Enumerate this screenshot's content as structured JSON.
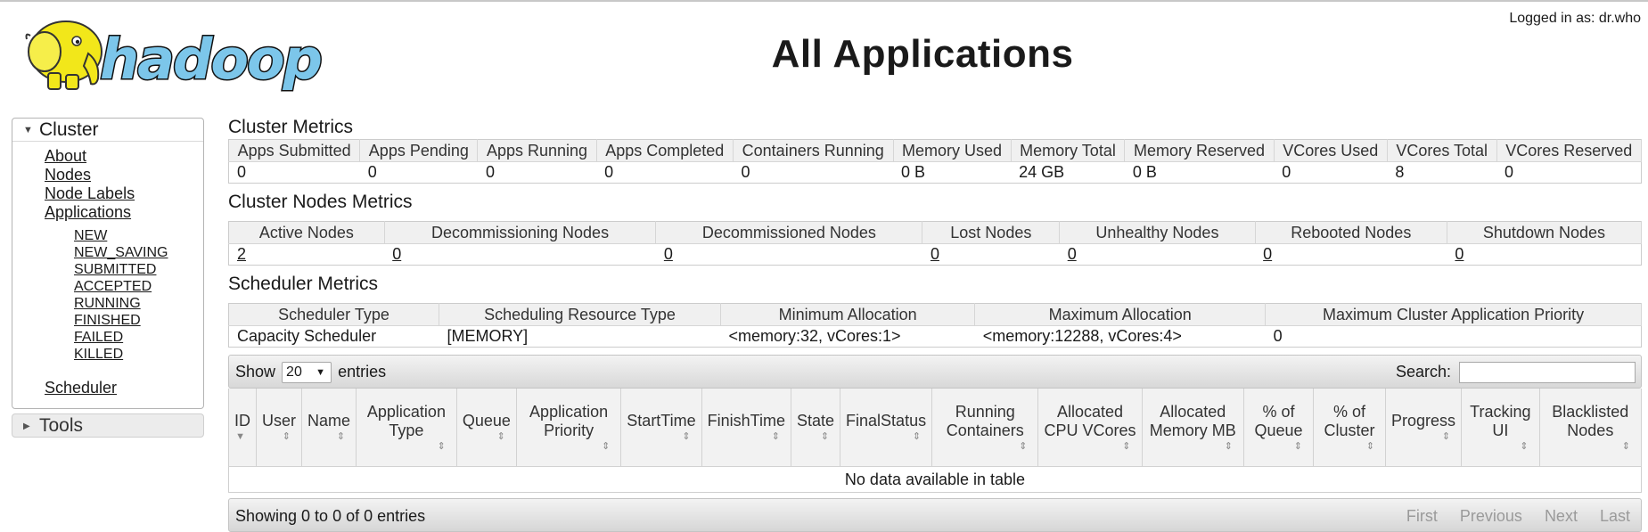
{
  "header": {
    "logo_text": "hadoop",
    "title": "All Applications",
    "user_info": "Logged in as: dr.who"
  },
  "sidebar": {
    "cluster_label": "Cluster",
    "links": [
      "About",
      "Nodes",
      "Node Labels",
      "Applications"
    ],
    "app_states": [
      "NEW",
      "NEW_SAVING",
      "SUBMITTED",
      "ACCEPTED",
      "RUNNING",
      "FINISHED",
      "FAILED",
      "KILLED"
    ],
    "scheduler_label": "Scheduler",
    "tools_label": "Tools"
  },
  "cluster_metrics": {
    "title": "Cluster Metrics",
    "headers": [
      "Apps Submitted",
      "Apps Pending",
      "Apps Running",
      "Apps Completed",
      "Containers Running",
      "Memory Used",
      "Memory Total",
      "Memory Reserved",
      "VCores Used",
      "VCores Total",
      "VCores Reserved"
    ],
    "values": [
      "0",
      "0",
      "0",
      "0",
      "0",
      "0 B",
      "24 GB",
      "0 B",
      "0",
      "8",
      "0"
    ]
  },
  "nodes_metrics": {
    "title": "Cluster Nodes Metrics",
    "headers": [
      "Active Nodes",
      "Decommissioning Nodes",
      "Decommissioned Nodes",
      "Lost Nodes",
      "Unhealthy Nodes",
      "Rebooted Nodes",
      "Shutdown Nodes"
    ],
    "values": [
      "2",
      "0",
      "0",
      "0",
      "0",
      "0",
      "0"
    ]
  },
  "scheduler_metrics": {
    "title": "Scheduler Metrics",
    "headers": [
      "Scheduler Type",
      "Scheduling Resource Type",
      "Minimum Allocation",
      "Maximum Allocation",
      "Maximum Cluster Application Priority"
    ],
    "values": [
      "Capacity Scheduler",
      "[MEMORY]",
      "<memory:32, vCores:1>",
      "<memory:12288, vCores:4>",
      "0"
    ]
  },
  "apps_table": {
    "show_label": "Show",
    "entries_label": "entries",
    "page_length": "20",
    "search_label": "Search:",
    "search_value": "",
    "columns": [
      "ID",
      "User",
      "Name",
      "Application Type",
      "Queue",
      "Application Priority",
      "StartTime",
      "FinishTime",
      "State",
      "FinalStatus",
      "Running Containers",
      "Allocated CPU VCores",
      "Allocated Memory MB",
      "% of Queue",
      "% of Cluster",
      "Progress",
      "Tracking UI",
      "Blacklisted Nodes"
    ],
    "empty_message": "No data available in table",
    "info": "Showing 0 to 0 of 0 entries",
    "pager": [
      "First",
      "Previous",
      "Next",
      "Last"
    ]
  }
}
